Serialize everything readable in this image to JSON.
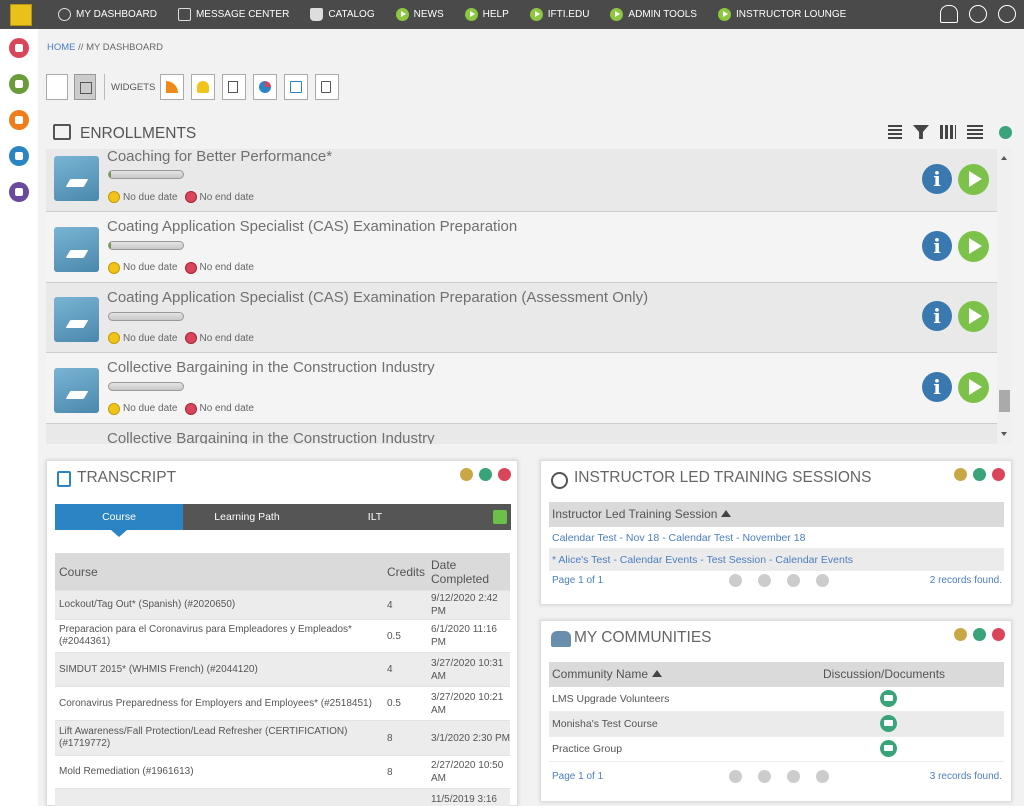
{
  "nav": {
    "items": [
      {
        "label": "MY DASHBOARD",
        "icon": "dashboard-icon"
      },
      {
        "label": "MESSAGE CENTER",
        "icon": "message-icon"
      },
      {
        "label": "CATALOG",
        "icon": "catalog-icon"
      },
      {
        "label": "NEWS",
        "icon": "play-icon"
      },
      {
        "label": "HELP",
        "icon": "play-icon"
      },
      {
        "label": "IFTI.EDU",
        "icon": "play-icon"
      },
      {
        "label": "ADMIN TOOLS",
        "icon": "play-icon"
      },
      {
        "label": "INSTRUCTOR LOUNGE",
        "icon": "play-icon"
      }
    ],
    "right_icons": [
      "bell-icon",
      "globe-icon",
      "user-icon"
    ]
  },
  "breadcrumb": {
    "home": "HOME",
    "sep": " // ",
    "current": "MY DASHBOARD"
  },
  "toolbar": {
    "widgets_label": "WIDGETS"
  },
  "enrollments": {
    "title": "ENROLLMENTS",
    "courses": [
      {
        "title": "Coaching for Better Performance*",
        "progress": 0.03,
        "due": "No due date",
        "end": "No end date"
      },
      {
        "title": "Coating Application Specialist (CAS) Examination Preparation",
        "progress": 0.03,
        "due": "No due date",
        "end": "No end date"
      },
      {
        "title": "Coating Application Specialist (CAS) Examination Preparation (Assessment Only)",
        "progress": 0,
        "due": "No due date",
        "end": "No end date"
      },
      {
        "title": "Collective Bargaining in the Construction Industry",
        "progress": 0,
        "due": "No due date",
        "end": "No end date"
      },
      {
        "title": "Collective Bargaining in the Construction Industry",
        "progress": 0,
        "due": "",
        "end": ""
      }
    ]
  },
  "transcript": {
    "title": "TRANSCRIPT",
    "tabs": [
      "Course",
      "Learning Path",
      "ILT"
    ],
    "headers": {
      "course": "Course",
      "credits": "Credits",
      "date": "Date Completed"
    },
    "rows": [
      {
        "course": "Lockout/Tag Out* (Spanish) (#2020650)",
        "credits": "4",
        "date": "9/12/2020 2:42 PM"
      },
      {
        "course": "Preparacion para el Coronavirus para Empleadores y Empleados* (#2044361)",
        "credits": "0.5",
        "date": "6/1/2020 11:16 PM"
      },
      {
        "course": "SIMDUT 2015* (WHMIS French) (#2044120)",
        "credits": "4",
        "date": "3/27/2020 10:31 AM"
      },
      {
        "course": "Coronavirus Preparedness for Employers and Employees* (#2518451)",
        "credits": "0.5",
        "date": "3/27/2020 10:21 AM"
      },
      {
        "course": "Lift Awareness/Fall Protection/Lead Refresher (CERTIFICATION) (#1719772)",
        "credits": "8",
        "date": "3/1/2020 2:30 PM"
      },
      {
        "course": "Mold Remediation (#1961613)",
        "credits": "8",
        "date": "2/27/2020 10:50 AM"
      },
      {
        "course": "",
        "credits": "",
        "date": "11/5/2019 3:16"
      }
    ]
  },
  "ilt": {
    "title": "INSTRUCTOR LED TRAINING SESSIONS",
    "header": "Instructor Led Training Session",
    "rows": [
      "Calendar Test - Nov 18 - Calendar Test - November 18",
      "* Alice's Test - Calendar Events - Test Session - Calendar Events"
    ],
    "page": "Page 1 of 1",
    "found": "2 records found."
  },
  "communities": {
    "title": "MY COMMUNITIES",
    "headers": {
      "name": "Community Name",
      "disc": "Discussion/Documents"
    },
    "rows": [
      "LMS Upgrade Volunteers",
      "Monisha's Test Course",
      "Practice Group"
    ],
    "page": "Page 1 of 1",
    "found": "3 records found."
  },
  "colors": {
    "nav_bg": "#4a4a4a",
    "accent_blue": "#2b84c4",
    "play_green": "#7cc24a",
    "info_blue": "#3a78b0"
  }
}
